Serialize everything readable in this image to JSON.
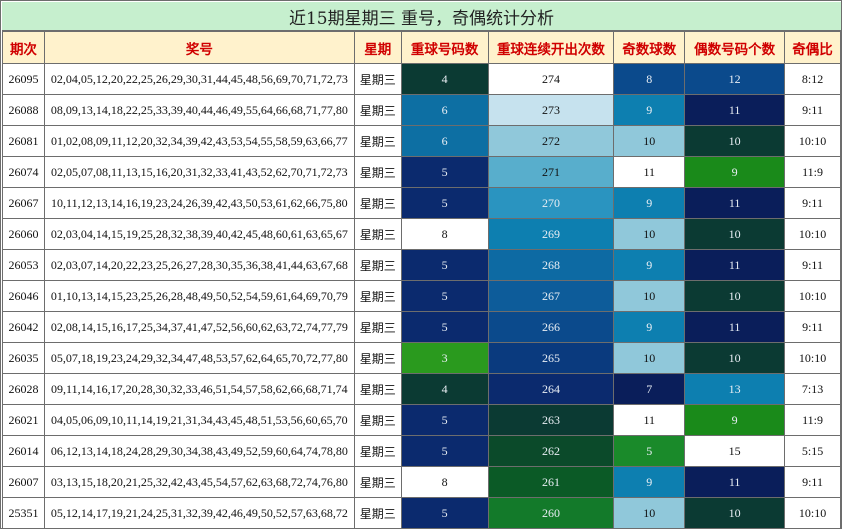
{
  "title": "近15期星期三 重号，奇偶统计分析",
  "headers": [
    "期次",
    "奖号",
    "星期",
    "重球号码数",
    "重球连续开出次数",
    "奇数球数",
    "偶数号码个数",
    "奇偶比"
  ],
  "rows": [
    {
      "issue": "26095",
      "numbers": "02,04,05,12,20,22,25,26,29,30,31,44,45,48,56,69,70,71,72,73",
      "weekday": "星期三",
      "repeat": "4",
      "consecutive": "274",
      "odd": "8",
      "even": "12",
      "ratio": "8:12"
    },
    {
      "issue": "26088",
      "numbers": "08,09,13,14,18,22,25,33,39,40,44,46,49,55,64,66,68,71,77,80",
      "weekday": "星期三",
      "repeat": "6",
      "consecutive": "273",
      "odd": "9",
      "even": "11",
      "ratio": "9:11"
    },
    {
      "issue": "26081",
      "numbers": "01,02,08,09,11,12,20,32,34,39,42,43,53,54,55,58,59,63,66,77",
      "weekday": "星期三",
      "repeat": "6",
      "consecutive": "272",
      "odd": "10",
      "even": "10",
      "ratio": "10:10"
    },
    {
      "issue": "26074",
      "numbers": "02,05,07,08,11,13,15,16,20,31,32,33,41,43,52,62,70,71,72,73",
      "weekday": "星期三",
      "repeat": "5",
      "consecutive": "271",
      "odd": "11",
      "even": "9",
      "ratio": "11:9"
    },
    {
      "issue": "26067",
      "numbers": "10,11,12,13,14,16,19,23,24,26,39,42,43,50,53,61,62,66,75,80",
      "weekday": "星期三",
      "repeat": "5",
      "consecutive": "270",
      "odd": "9",
      "even": "11",
      "ratio": "9:11"
    },
    {
      "issue": "26060",
      "numbers": "02,03,04,14,15,19,25,28,32,38,39,40,42,45,48,60,61,63,65,67",
      "weekday": "星期三",
      "repeat": "8",
      "consecutive": "269",
      "odd": "10",
      "even": "10",
      "ratio": "10:10"
    },
    {
      "issue": "26053",
      "numbers": "02,03,07,14,20,22,23,25,26,27,28,30,35,36,38,41,44,63,67,68",
      "weekday": "星期三",
      "repeat": "5",
      "consecutive": "268",
      "odd": "9",
      "even": "11",
      "ratio": "9:11"
    },
    {
      "issue": "26046",
      "numbers": "01,10,13,14,15,23,25,26,28,48,49,50,52,54,59,61,64,69,70,79",
      "weekday": "星期三",
      "repeat": "5",
      "consecutive": "267",
      "odd": "10",
      "even": "10",
      "ratio": "10:10"
    },
    {
      "issue": "26042",
      "numbers": "02,08,14,15,16,17,25,34,37,41,47,52,56,60,62,63,72,74,77,79",
      "weekday": "星期三",
      "repeat": "5",
      "consecutive": "266",
      "odd": "9",
      "even": "11",
      "ratio": "9:11"
    },
    {
      "issue": "26035",
      "numbers": "05,07,18,19,23,24,29,32,34,47,48,53,57,62,64,65,70,72,77,80",
      "weekday": "星期三",
      "repeat": "3",
      "consecutive": "265",
      "odd": "10",
      "even": "10",
      "ratio": "10:10"
    },
    {
      "issue": "26028",
      "numbers": "09,11,14,16,17,20,28,30,32,33,46,51,54,57,58,62,66,68,71,74",
      "weekday": "星期三",
      "repeat": "4",
      "consecutive": "264",
      "odd": "7",
      "even": "13",
      "ratio": "7:13"
    },
    {
      "issue": "26021",
      "numbers": "04,05,06,09,10,11,14,19,21,31,34,43,45,48,51,53,56,60,65,70",
      "weekday": "星期三",
      "repeat": "5",
      "consecutive": "263",
      "odd": "11",
      "even": "9",
      "ratio": "11:9"
    },
    {
      "issue": "26014",
      "numbers": "06,12,13,14,18,24,28,29,30,34,38,43,49,52,59,60,64,74,78,80",
      "weekday": "星期三",
      "repeat": "5",
      "consecutive": "262",
      "odd": "5",
      "even": "15",
      "ratio": "5:15"
    },
    {
      "issue": "26007",
      "numbers": "03,13,15,18,20,21,25,32,42,43,45,54,57,62,63,68,72,74,76,80",
      "weekday": "星期三",
      "repeat": "8",
      "consecutive": "261",
      "odd": "9",
      "even": "11",
      "ratio": "9:11"
    },
    {
      "issue": "25351",
      "numbers": "05,12,14,17,19,21,24,25,31,32,39,42,46,49,50,52,57,63,68,72",
      "weekday": "星期三",
      "repeat": "5",
      "consecutive": "260",
      "odd": "10",
      "even": "10",
      "ratio": "10:10"
    }
  ],
  "cell_colors": {
    "repeat": [
      "#0b3a33",
      "#0d6fa3",
      "#0d6fa3",
      "#0b2a6e",
      "#0b2a6e",
      "#ffffff",
      "#0b2a6e",
      "#0b2a6e",
      "#0b2a6e",
      "#2a9a1e",
      "#0b3a33",
      "#0b2a6e",
      "#0b2a6e",
      "#ffffff",
      "#0b2a6e"
    ],
    "consecutive": [
      "#ffffff",
      "#c6e2ee",
      "#90c8da",
      "#58aecc",
      "#2a94c0",
      "#0d7fb0",
      "#0d6aa3",
      "#0d5c9a",
      "#0b4a8c",
      "#0a3a7e",
      "#0b2a6e",
      "#0b3a33",
      "#0b4a2a",
      "#0b5a26",
      "#137a2a"
    ],
    "odd": [
      "#0b4a8c",
      "#0d7fb0",
      "#90c8da",
      "#ffffff",
      "#0d7fb0",
      "#90c8da",
      "#0d7fb0",
      "#90c8da",
      "#0d7fb0",
      "#90c8da",
      "#0a1e5a",
      "#ffffff",
      "#1a8a2a",
      "#0d7fb0",
      "#90c8da"
    ],
    "even": [
      "#0b4a8c",
      "#0a1e5a",
      "#0b3a33",
      "#1a8a1a",
      "#0a1e5a",
      "#0b3a33",
      "#0a1e5a",
      "#0b3a33",
      "#0a1e5a",
      "#0b3a33",
      "#0d7fb0",
      "#1a8a1a",
      "#ffffff",
      "#0a1e5a",
      "#0b3a33"
    ]
  }
}
